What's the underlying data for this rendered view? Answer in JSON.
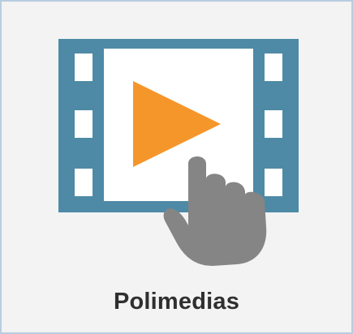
{
  "tile": {
    "label": "Polimedias",
    "icon": "video-play-touch-icon"
  },
  "colors": {
    "film_frame": "#4e8aa6",
    "play_triangle": "#f5962b",
    "hand": "#858585",
    "tile_background": "#f3f3f3",
    "tile_border": "#b9cde0",
    "label_text": "#2f2f2f"
  }
}
